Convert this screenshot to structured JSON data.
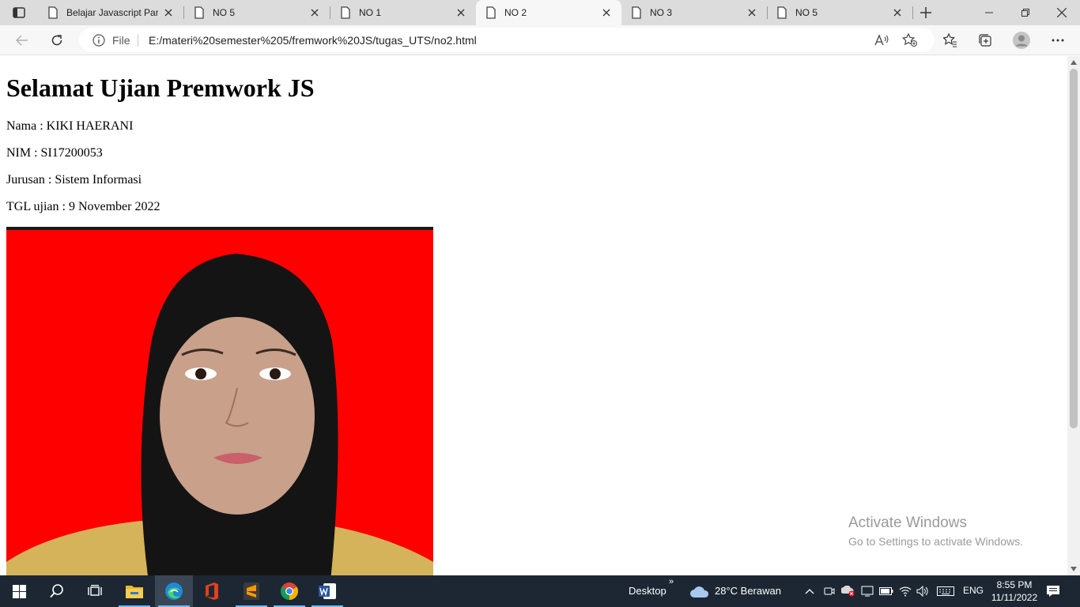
{
  "browser": {
    "tabs": [
      {
        "title": "Belajar Javascript Part",
        "active": false
      },
      {
        "title": "NO 5",
        "active": false
      },
      {
        "title": "NO 1",
        "active": false
      },
      {
        "title": "NO 2",
        "active": true
      },
      {
        "title": "NO 3",
        "active": false
      },
      {
        "title": "NO 5",
        "active": false
      }
    ],
    "address": {
      "scheme": "File",
      "url": "E:/materi%20semester%205/fremwork%20JS/tugas_UTS/no2.html"
    }
  },
  "page": {
    "heading": "Selamat Ujian Premwork JS",
    "nama": "Nama : KIKI HAERANI",
    "nim": "NIM : SI17200053",
    "jurusan": "Jurusan : Sistem Informasi",
    "tgl": "TGL ujian : 9 November 2022",
    "photo_background": "#ff0000"
  },
  "watermark": {
    "title": "Activate Windows",
    "subtitle": "Go to Settings to activate Windows."
  },
  "taskbar": {
    "apps": [
      "start-icon",
      "search-icon",
      "task-view-icon",
      "file-explorer-icon",
      "edge-icon",
      "office-icon",
      "sublime-text-icon",
      "chrome-icon",
      "word-icon"
    ],
    "desktop_label": "Desktop",
    "weather": "28°C  Berawan",
    "language": "ENG",
    "time": "8:55 PM",
    "date": "11/11/2022"
  }
}
